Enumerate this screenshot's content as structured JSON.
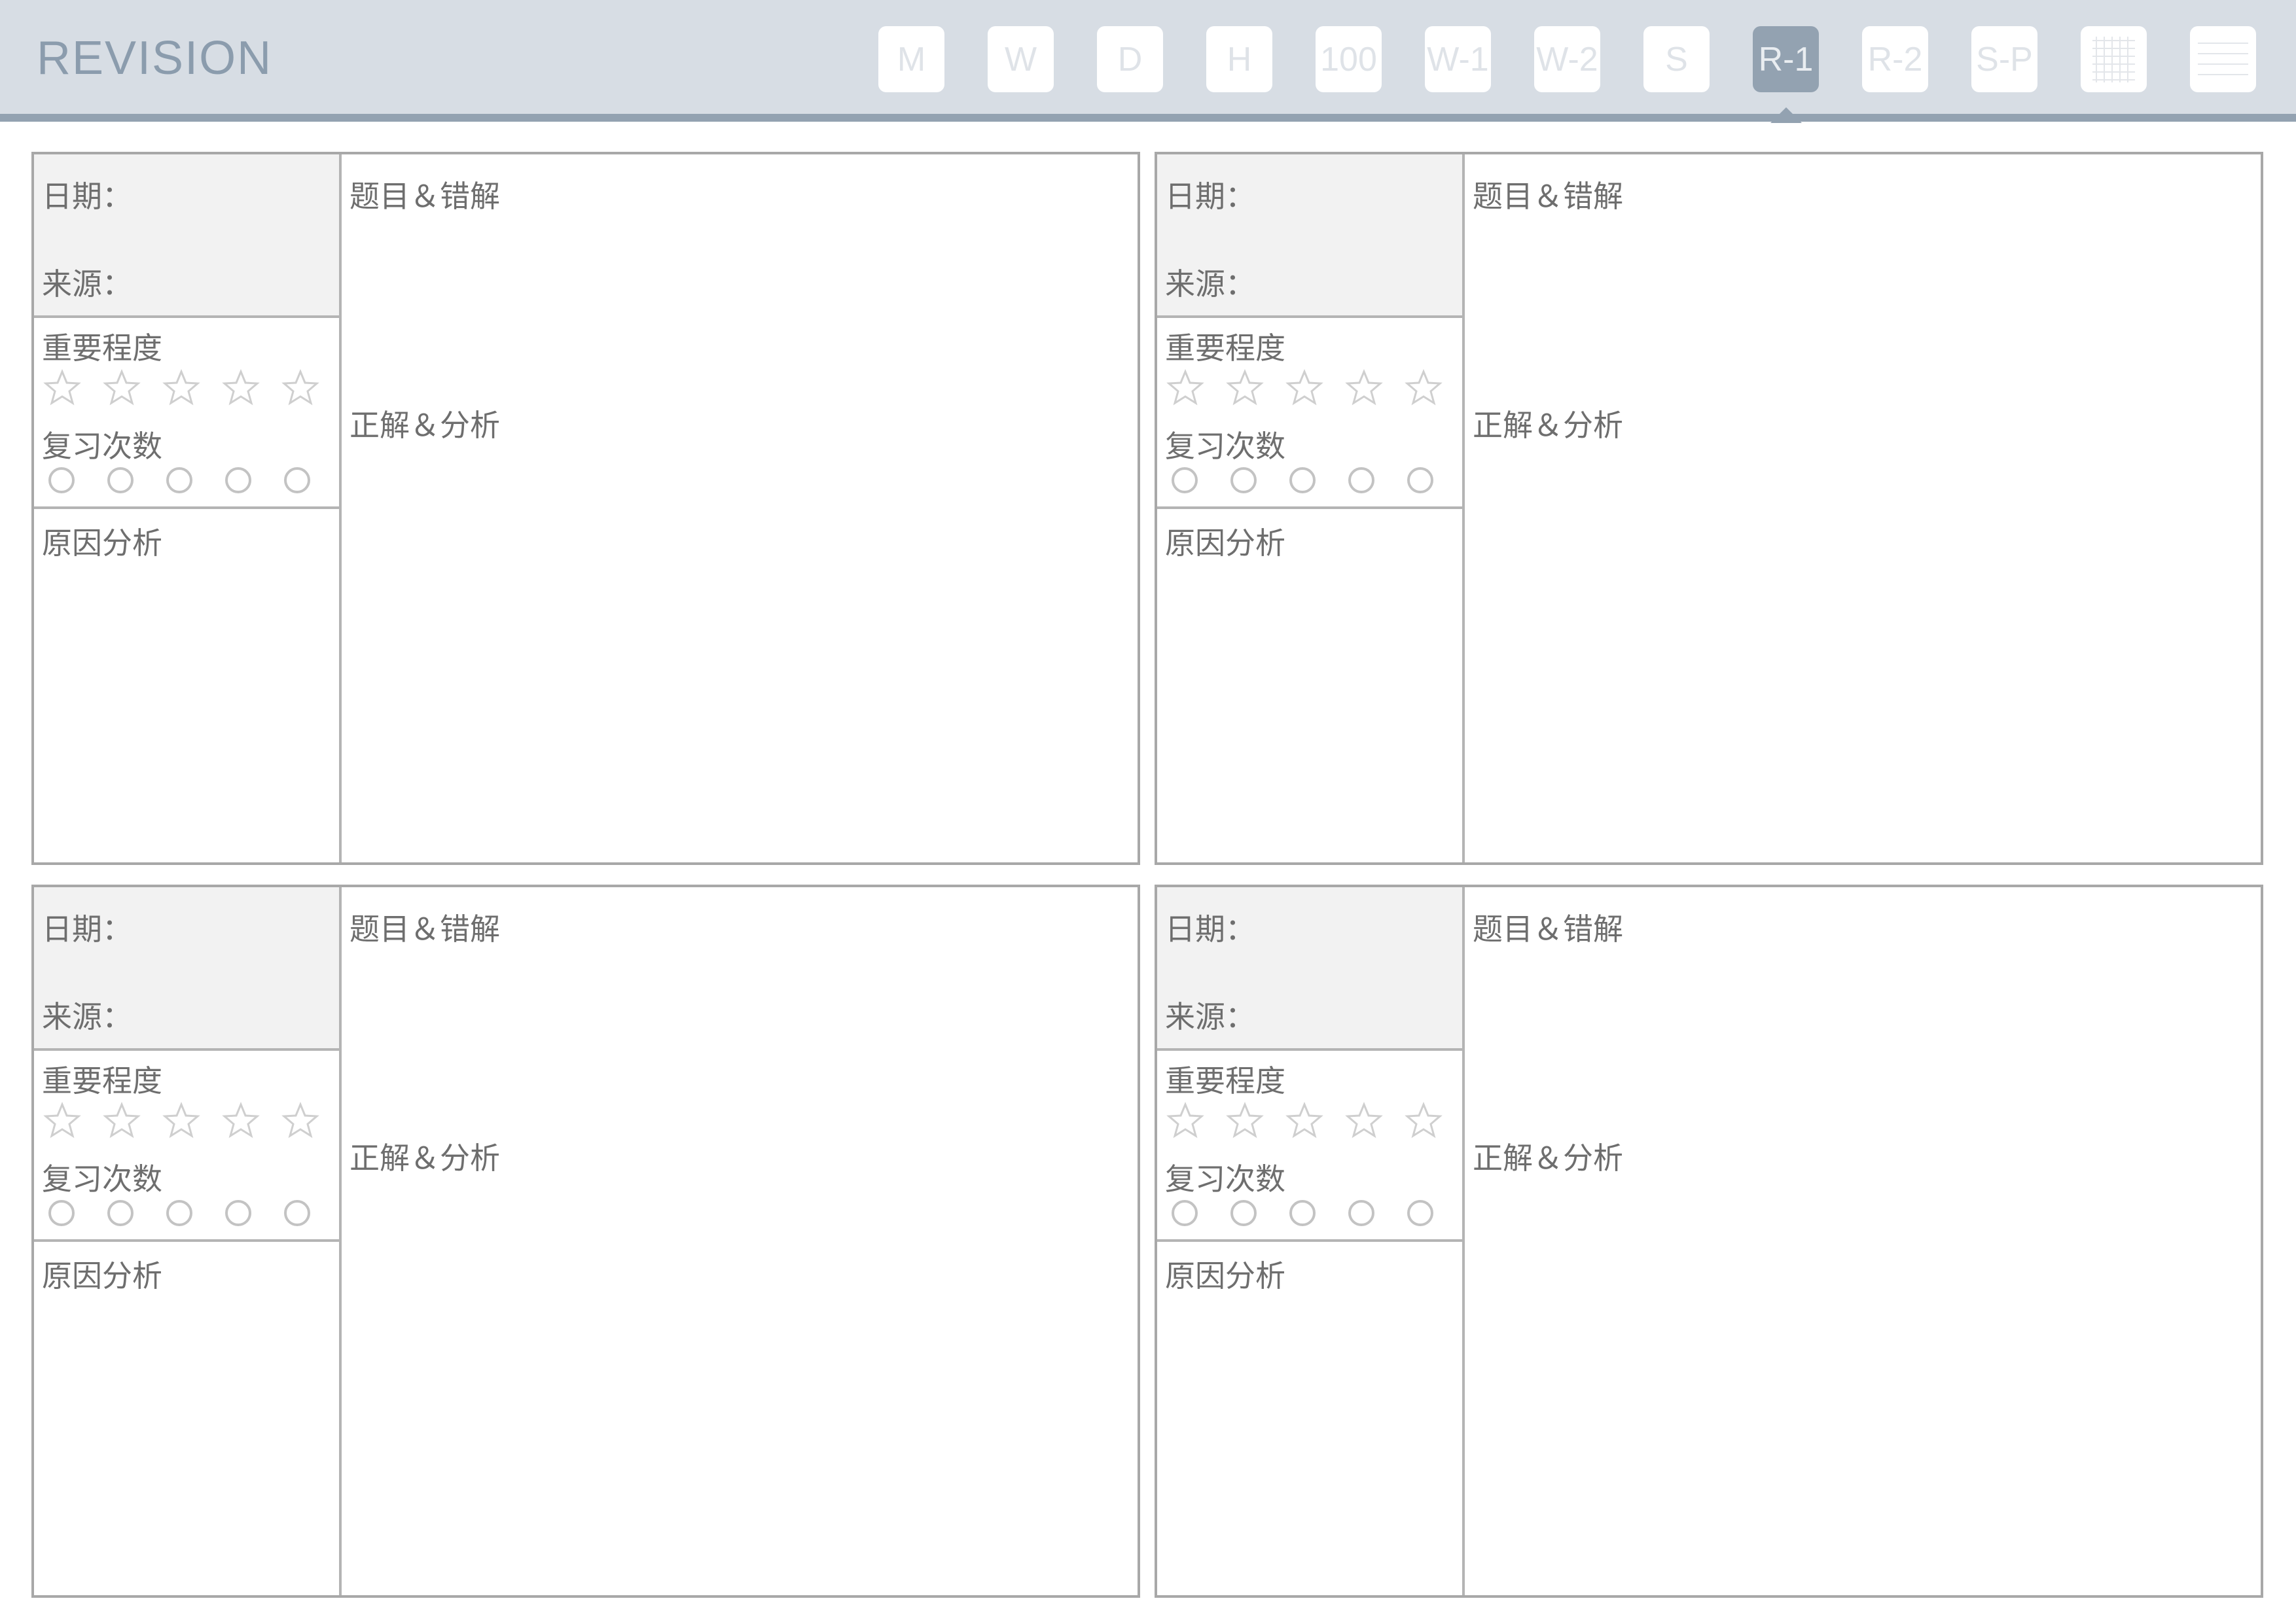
{
  "header": {
    "brand": "REVISION",
    "tabs": [
      {
        "label": "M"
      },
      {
        "label": "W"
      },
      {
        "label": "D"
      },
      {
        "label": "H"
      },
      {
        "label": "100"
      },
      {
        "label": "W-1"
      },
      {
        "label": "W-2"
      },
      {
        "label": "S"
      },
      {
        "label": "R-1",
        "active": true
      },
      {
        "label": "R-2"
      },
      {
        "label": "S-P"
      },
      {
        "icon": "grid-icon"
      },
      {
        "icon": "lines-icon"
      }
    ]
  },
  "card_labels": {
    "date": "日期：",
    "source": "来源：",
    "importance": "重要程度",
    "review_count": "复习次数",
    "cause": "原因分析",
    "question": "题目＆错解",
    "answer": "正解＆分析"
  },
  "card_count": 4,
  "importance_stars": 5,
  "review_circles": 5,
  "colors": {
    "header_bg": "#d7dde4",
    "accent": "#93a2b1",
    "border": "#a8a8a8",
    "meta_bg": "#f2f2f2"
  }
}
